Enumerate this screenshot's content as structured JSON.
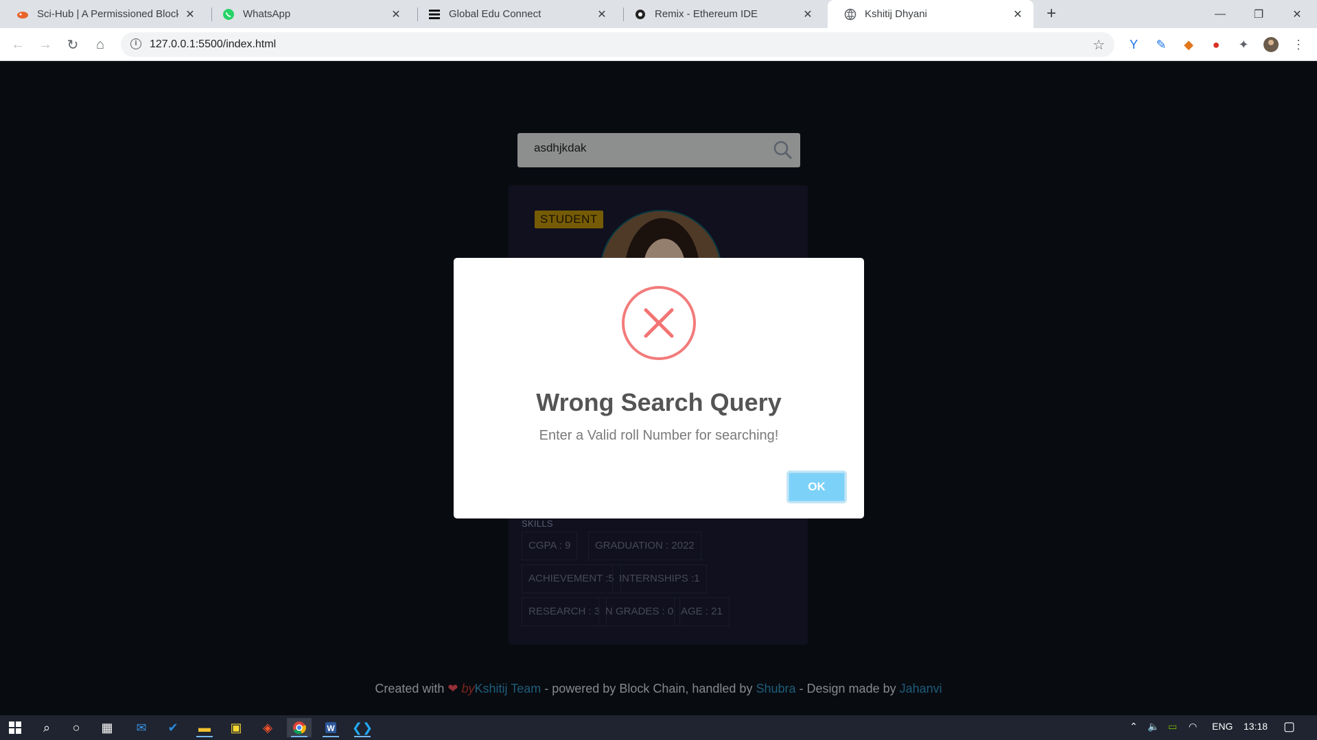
{
  "browser": {
    "tabs": [
      {
        "title": "Sci-Hub | A Permissioned Blockch",
        "favicon": "scihub-icon"
      },
      {
        "title": "WhatsApp",
        "favicon": "whatsapp-icon"
      },
      {
        "title": "Global Edu Connect",
        "favicon": "menu-icon"
      },
      {
        "title": "Remix - Ethereum IDE",
        "favicon": "remix-icon"
      },
      {
        "title": "Kshitij Dhyani",
        "favicon": "globe-icon"
      }
    ],
    "url": "127.0.0.1:5500/index.html"
  },
  "search": {
    "value": "asdhjkdak"
  },
  "profile": {
    "role_badge": "STUDENT",
    "skills_title": "SKILLS",
    "skills": [
      "CGPA : 9",
      "GRADUATION : 2022",
      "ACHIEVEMENT :5",
      "INTERNSHIPS :1",
      "RESEARCH : 3",
      "N GRADES : 0",
      "AGE : 21"
    ]
  },
  "footer": {
    "created_with": "Created with",
    "heart": "❤",
    "by": "by",
    "team": "Kshitij Team",
    "powered": "- powered by Block Chain, handled by",
    "handler": "Shubra",
    "design": "- Design made by",
    "designer": "Jahanvi"
  },
  "modal": {
    "title": "Wrong Search Query",
    "text": "Enter a Valid roll Number for searching!",
    "ok_label": "OK",
    "icon": "error-x-icon",
    "accent": "#f27474"
  },
  "taskbar": {
    "lang": "ENG",
    "time": "13:18"
  }
}
